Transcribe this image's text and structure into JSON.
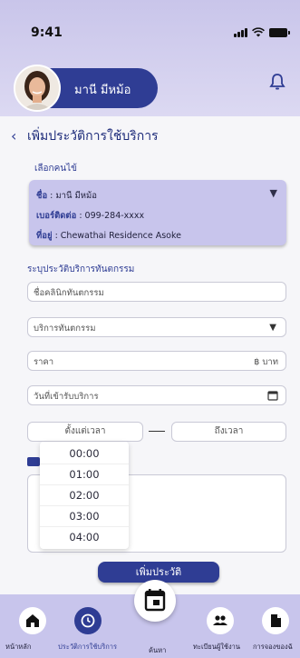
{
  "status": {
    "time": "9:41"
  },
  "user": {
    "name": "มานี มีหม้อ"
  },
  "page": {
    "title": "เพิ่มประวัติการใช้บริการ"
  },
  "patient_section": {
    "label": "เลือกคนไข้",
    "name_label": "ชื่อ",
    "name_value": " : มานี มีหม้อ",
    "phone_label": "เบอร์ติดต่อ",
    "phone_value": " : 099-284-xxxx",
    "address_label": "ที่อยู่",
    "address_value": " : Chewathai Residence Asoke"
  },
  "service_section": {
    "label": "ระบุประวัติบริการทันตกรรม",
    "clinic_placeholder": "ชื่อคลินิกทันตกรรม",
    "service_placeholder": "บริการทันตกรรม",
    "price_placeholder": "ราคา",
    "price_unit": "฿ บาท",
    "date_placeholder": "วันที่เข้ารับบริการ",
    "time_from": "ตั้งแต่เวลา",
    "time_to": "ถึงเวลา"
  },
  "time_dropdown": {
    "options": [
      "00:00",
      "01:00",
      "02:00",
      "03:00",
      "04:00"
    ]
  },
  "actions": {
    "submit_label": "เพิ่มประวัติ"
  },
  "bottom_nav": {
    "items": [
      {
        "label": "หน้าหลัก",
        "icon": "home-icon"
      },
      {
        "label": "ประวัติการใช้บริการ",
        "icon": "history-icon"
      },
      {
        "label": "ค้นหา",
        "icon": "calendar-icon"
      },
      {
        "label": "ทะเบียนผู้ใช้งาน",
        "icon": "users-icon"
      },
      {
        "label": "การจองของฉั",
        "icon": "document-icon"
      }
    ]
  },
  "colors": {
    "primary": "#2f3d94",
    "card": "#c8c5ec",
    "header": "#c9c5ea",
    "nav": "#c8c5ec"
  }
}
